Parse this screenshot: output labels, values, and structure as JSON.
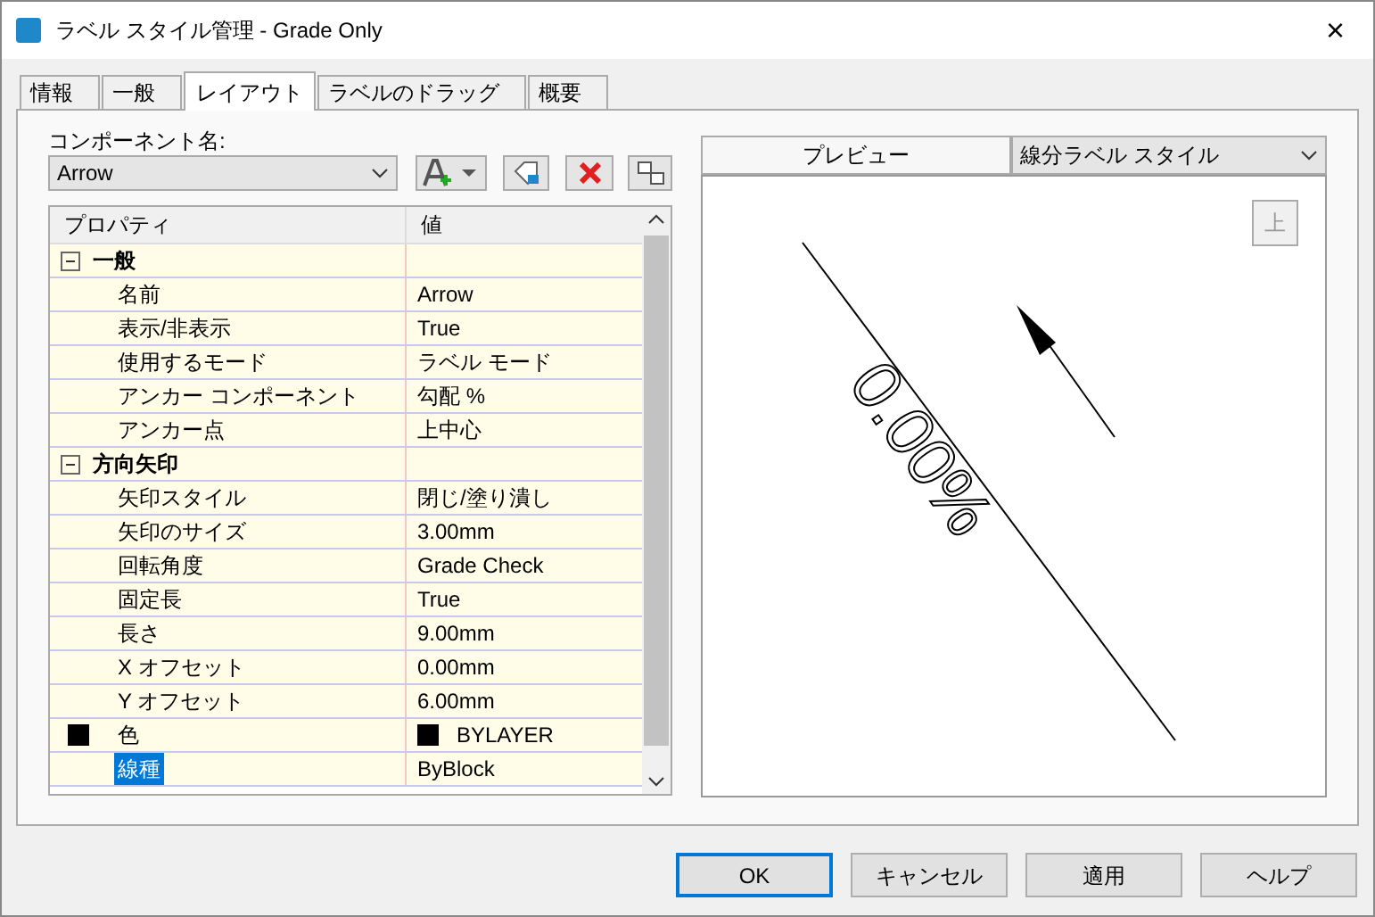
{
  "window": {
    "title": "ラベル スタイル管理 - Grade Only",
    "close": "×"
  },
  "tabs": [
    {
      "label": "情報",
      "selected": false
    },
    {
      "label": "一般",
      "selected": false
    },
    {
      "label": "レイアウト",
      "selected": true
    },
    {
      "label": "ラベルのドラッグ",
      "selected": false
    },
    {
      "label": "概要",
      "selected": false
    }
  ],
  "component": {
    "label": "コンポーネント名:",
    "value": "Arrow"
  },
  "table": {
    "columns": [
      "プロパティ",
      "値"
    ],
    "rows": [
      {
        "kind": "group",
        "property": "一般",
        "expanded": true
      },
      {
        "kind": "item",
        "property": "名前",
        "value": "Arrow",
        "selected": false
      },
      {
        "kind": "item",
        "property": "表示/非表示",
        "value": "True",
        "selected": false
      },
      {
        "kind": "item",
        "property": "使用するモード",
        "value": "ラベル モード",
        "selected": false
      },
      {
        "kind": "item",
        "property": "アンカー コンポーネント",
        "value": "勾配 %",
        "selected": false
      },
      {
        "kind": "item",
        "property": "アンカー点",
        "value": "上中心",
        "selected": false
      },
      {
        "kind": "group",
        "property": "方向矢印",
        "expanded": true
      },
      {
        "kind": "item",
        "property": "矢印スタイル",
        "value": "閉じ/塗り潰し",
        "selected": false
      },
      {
        "kind": "item",
        "property": "矢印のサイズ",
        "value": "3.00mm",
        "selected": false
      },
      {
        "kind": "item",
        "property": "回転角度",
        "value": "Grade Check",
        "selected": false
      },
      {
        "kind": "item",
        "property": "固定長",
        "value": "True",
        "selected": false
      },
      {
        "kind": "item",
        "property": "長さ",
        "value": "9.00mm",
        "selected": false
      },
      {
        "kind": "item",
        "property": "X オフセット",
        "value": "0.00mm",
        "selected": false
      },
      {
        "kind": "item",
        "property": "Y オフセット",
        "value": "6.00mm",
        "selected": false
      },
      {
        "kind": "swatch",
        "property": "色",
        "value": "BYLAYER",
        "color": "#000000",
        "selected": false
      },
      {
        "kind": "item",
        "property": "線種",
        "value": "ByBlock",
        "selected": true
      }
    ]
  },
  "preview": {
    "tab": "プレビュー",
    "style": "線分ラベル スタイル",
    "up_button": {
      "label": "上",
      "disabled": true
    },
    "label_text": "0.00%"
  },
  "buttons": [
    {
      "label": "OK",
      "default": true
    },
    {
      "label": "キャンセル",
      "default": false
    },
    {
      "label": "適用",
      "default": false
    },
    {
      "label": "ヘルプ",
      "default": false
    }
  ]
}
